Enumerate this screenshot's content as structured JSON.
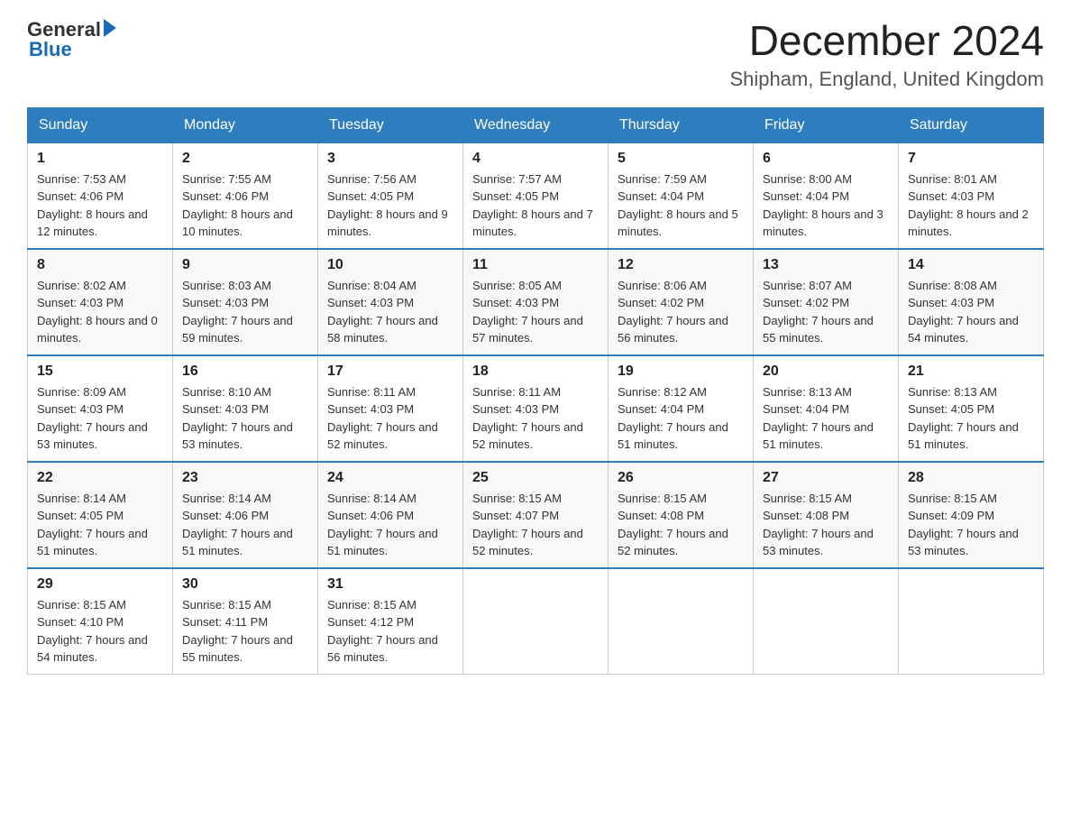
{
  "logo": {
    "text_general": "General",
    "text_blue": "Blue"
  },
  "header": {
    "title": "December 2024",
    "subtitle": "Shipham, England, United Kingdom"
  },
  "days_of_week": [
    "Sunday",
    "Monday",
    "Tuesday",
    "Wednesday",
    "Thursday",
    "Friday",
    "Saturday"
  ],
  "weeks": [
    [
      {
        "day": "1",
        "sunrise": "7:53 AM",
        "sunset": "4:06 PM",
        "daylight": "8 hours and 12 minutes."
      },
      {
        "day": "2",
        "sunrise": "7:55 AM",
        "sunset": "4:06 PM",
        "daylight": "8 hours and 10 minutes."
      },
      {
        "day": "3",
        "sunrise": "7:56 AM",
        "sunset": "4:05 PM",
        "daylight": "8 hours and 9 minutes."
      },
      {
        "day": "4",
        "sunrise": "7:57 AM",
        "sunset": "4:05 PM",
        "daylight": "8 hours and 7 minutes."
      },
      {
        "day": "5",
        "sunrise": "7:59 AM",
        "sunset": "4:04 PM",
        "daylight": "8 hours and 5 minutes."
      },
      {
        "day": "6",
        "sunrise": "8:00 AM",
        "sunset": "4:04 PM",
        "daylight": "8 hours and 3 minutes."
      },
      {
        "day": "7",
        "sunrise": "8:01 AM",
        "sunset": "4:03 PM",
        "daylight": "8 hours and 2 minutes."
      }
    ],
    [
      {
        "day": "8",
        "sunrise": "8:02 AM",
        "sunset": "4:03 PM",
        "daylight": "8 hours and 0 minutes."
      },
      {
        "day": "9",
        "sunrise": "8:03 AM",
        "sunset": "4:03 PM",
        "daylight": "7 hours and 59 minutes."
      },
      {
        "day": "10",
        "sunrise": "8:04 AM",
        "sunset": "4:03 PM",
        "daylight": "7 hours and 58 minutes."
      },
      {
        "day": "11",
        "sunrise": "8:05 AM",
        "sunset": "4:03 PM",
        "daylight": "7 hours and 57 minutes."
      },
      {
        "day": "12",
        "sunrise": "8:06 AM",
        "sunset": "4:02 PM",
        "daylight": "7 hours and 56 minutes."
      },
      {
        "day": "13",
        "sunrise": "8:07 AM",
        "sunset": "4:02 PM",
        "daylight": "7 hours and 55 minutes."
      },
      {
        "day": "14",
        "sunrise": "8:08 AM",
        "sunset": "4:03 PM",
        "daylight": "7 hours and 54 minutes."
      }
    ],
    [
      {
        "day": "15",
        "sunrise": "8:09 AM",
        "sunset": "4:03 PM",
        "daylight": "7 hours and 53 minutes."
      },
      {
        "day": "16",
        "sunrise": "8:10 AM",
        "sunset": "4:03 PM",
        "daylight": "7 hours and 53 minutes."
      },
      {
        "day": "17",
        "sunrise": "8:11 AM",
        "sunset": "4:03 PM",
        "daylight": "7 hours and 52 minutes."
      },
      {
        "day": "18",
        "sunrise": "8:11 AM",
        "sunset": "4:03 PM",
        "daylight": "7 hours and 52 minutes."
      },
      {
        "day": "19",
        "sunrise": "8:12 AM",
        "sunset": "4:04 PM",
        "daylight": "7 hours and 51 minutes."
      },
      {
        "day": "20",
        "sunrise": "8:13 AM",
        "sunset": "4:04 PM",
        "daylight": "7 hours and 51 minutes."
      },
      {
        "day": "21",
        "sunrise": "8:13 AM",
        "sunset": "4:05 PM",
        "daylight": "7 hours and 51 minutes."
      }
    ],
    [
      {
        "day": "22",
        "sunrise": "8:14 AM",
        "sunset": "4:05 PM",
        "daylight": "7 hours and 51 minutes."
      },
      {
        "day": "23",
        "sunrise": "8:14 AM",
        "sunset": "4:06 PM",
        "daylight": "7 hours and 51 minutes."
      },
      {
        "day": "24",
        "sunrise": "8:14 AM",
        "sunset": "4:06 PM",
        "daylight": "7 hours and 51 minutes."
      },
      {
        "day": "25",
        "sunrise": "8:15 AM",
        "sunset": "4:07 PM",
        "daylight": "7 hours and 52 minutes."
      },
      {
        "day": "26",
        "sunrise": "8:15 AM",
        "sunset": "4:08 PM",
        "daylight": "7 hours and 52 minutes."
      },
      {
        "day": "27",
        "sunrise": "8:15 AM",
        "sunset": "4:08 PM",
        "daylight": "7 hours and 53 minutes."
      },
      {
        "day": "28",
        "sunrise": "8:15 AM",
        "sunset": "4:09 PM",
        "daylight": "7 hours and 53 minutes."
      }
    ],
    [
      {
        "day": "29",
        "sunrise": "8:15 AM",
        "sunset": "4:10 PM",
        "daylight": "7 hours and 54 minutes."
      },
      {
        "day": "30",
        "sunrise": "8:15 AM",
        "sunset": "4:11 PM",
        "daylight": "7 hours and 55 minutes."
      },
      {
        "day": "31",
        "sunrise": "8:15 AM",
        "sunset": "4:12 PM",
        "daylight": "7 hours and 56 minutes."
      },
      null,
      null,
      null,
      null
    ]
  ]
}
